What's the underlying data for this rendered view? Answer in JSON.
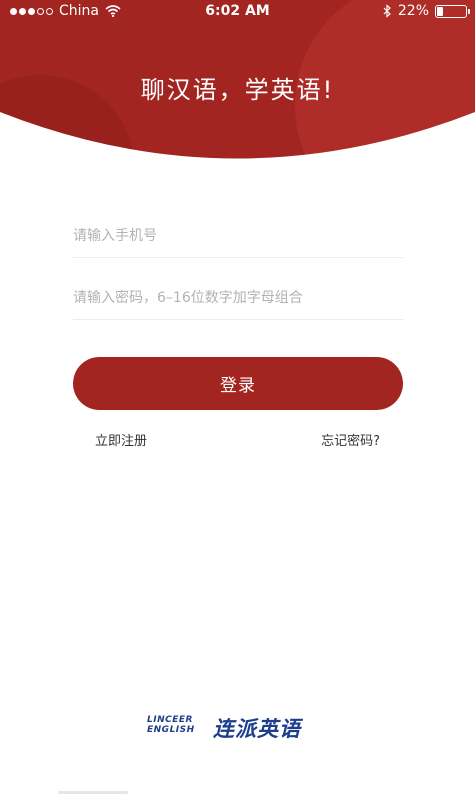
{
  "status_bar": {
    "carrier": "China",
    "time": "6:02 AM",
    "battery_percent": "22%",
    "battery_level": 0.22,
    "signal_bars_filled": 3,
    "signal_bars_total": 5,
    "icons": [
      "signal-dots-icon",
      "wifi-icon",
      "bluetooth-icon",
      "battery-icon"
    ]
  },
  "header": {
    "slogan": "聊汉语，学英语!",
    "colors": {
      "primary": "#a32521",
      "dark": "#8f1f1c",
      "highlight": "#b8342f"
    }
  },
  "form": {
    "phone_placeholder": "请输入手机号",
    "phone_value": "",
    "password_placeholder": "请输入密码，6–16位数字加字母组合",
    "password_value": "",
    "login_label": "登录",
    "register_link": "立即注册",
    "forgot_link": "忘记密码?"
  },
  "brand": {
    "name_en_line1": "LINCEER",
    "name_en_line2": "ENGLISH",
    "name_cn": "连派英语",
    "color": "#1e3e8c"
  }
}
